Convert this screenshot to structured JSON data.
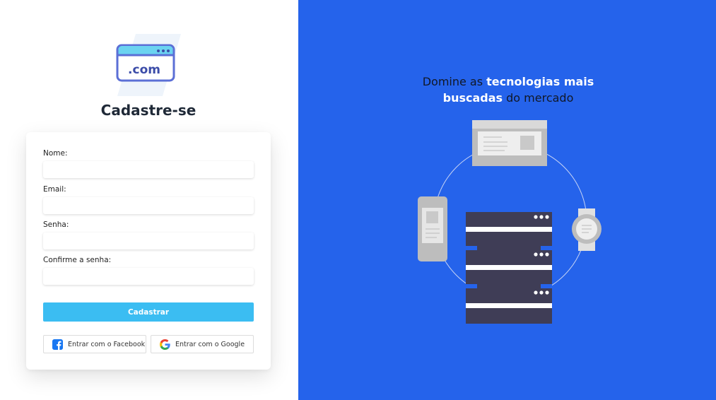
{
  "logo": {
    "text": ".com"
  },
  "page_title": "Cadastre-se",
  "form": {
    "fields": [
      {
        "label": "Nome:",
        "value": "",
        "placeholder": ""
      },
      {
        "label": "Email:",
        "value": "",
        "placeholder": ""
      },
      {
        "label": "Senha:",
        "value": "",
        "placeholder": ""
      },
      {
        "label": "Confirme a senha:",
        "value": "",
        "placeholder": ""
      }
    ],
    "submit_label": "Cadastrar",
    "facebook_label": "Entrar com o Facebook",
    "google_label": "Entrar com o Google"
  },
  "hero": {
    "tagline_1": "Domine as ",
    "tagline_highlight_1": "tecnologias mais buscadas",
    "tagline_2": " do mercado"
  },
  "colors": {
    "accent": "#2563eb",
    "button": "#3bbdf2",
    "server": "#3f3d56",
    "facebook": "#1877f2"
  }
}
